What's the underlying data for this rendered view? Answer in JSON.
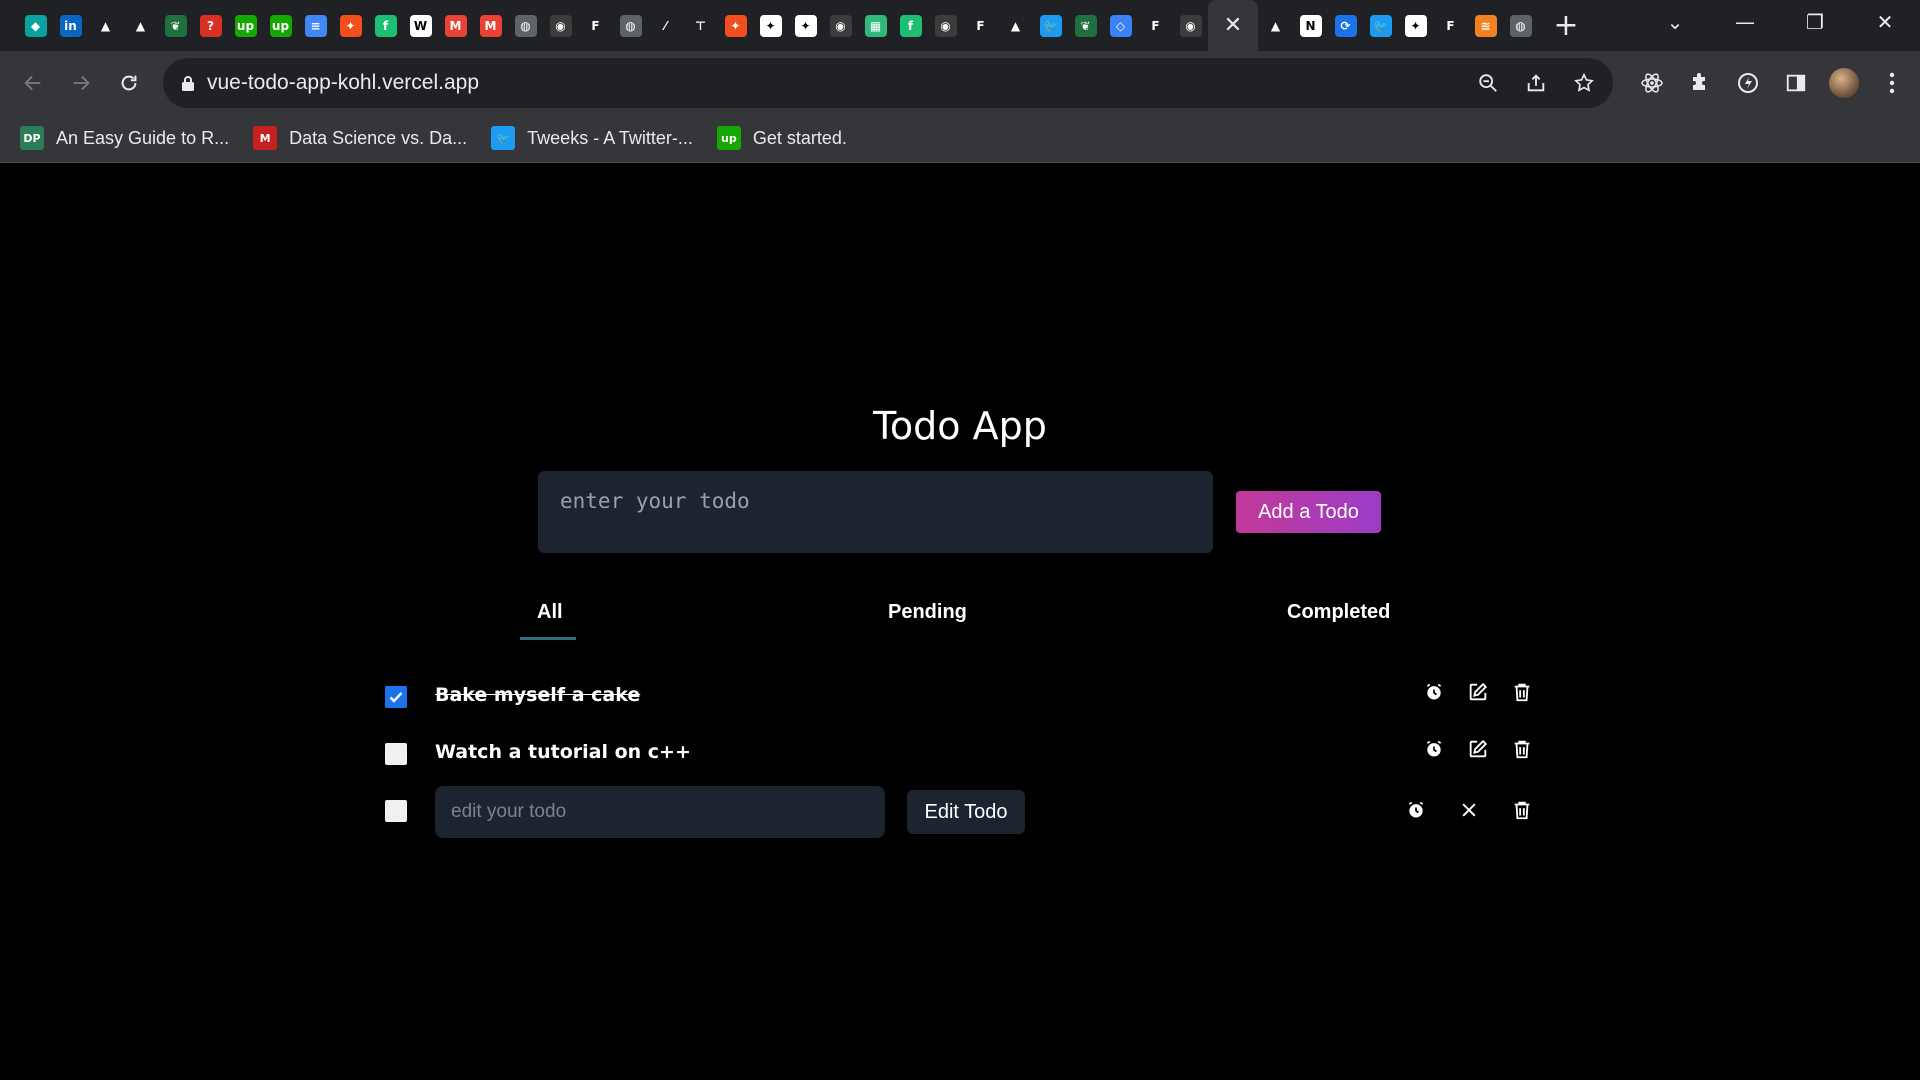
{
  "browser": {
    "tab_favicons": [
      {
        "name": "sourcegraph-icon",
        "glyph": "◆",
        "color": "#0aa2a0"
      },
      {
        "name": "linkedin-icon",
        "glyph": "in",
        "color": "#0a66c2"
      },
      {
        "name": "triangle-icon",
        "glyph": "▲",
        "color": "#202124"
      },
      {
        "name": "triangle-icon",
        "glyph": "▲",
        "color": "#202124"
      },
      {
        "name": "mongodb-leaf-icon",
        "glyph": "❦",
        "color": "#1f6f3f"
      },
      {
        "name": "question-icon",
        "glyph": "?",
        "color": "#d93025"
      },
      {
        "name": "upwork-icon",
        "glyph": "up",
        "color": "#14a800"
      },
      {
        "name": "upwork-icon",
        "glyph": "up",
        "color": "#14a800"
      },
      {
        "name": "google-docs-icon",
        "glyph": "≡",
        "color": "#4285f4"
      },
      {
        "name": "figma-icon",
        "glyph": "✦",
        "color": "#f24e1e"
      },
      {
        "name": "fiverr-icon",
        "glyph": "f",
        "color": "#1dbf73"
      },
      {
        "name": "wikipedia-icon",
        "glyph": "W",
        "color": "#ffffff"
      },
      {
        "name": "gmail-icon",
        "glyph": "M",
        "color": "#ea4335"
      },
      {
        "name": "gmail-icon",
        "glyph": "M",
        "color": "#ea4335"
      },
      {
        "name": "globe-icon",
        "glyph": "◍",
        "color": "#5f6368"
      },
      {
        "name": "github-icon",
        "glyph": "◉",
        "color": "#3c3c3c"
      },
      {
        "name": "f-letter-icon",
        "glyph": "F",
        "color": "#202124"
      },
      {
        "name": "globe-icon",
        "glyph": "◍",
        "color": "#5f6368"
      },
      {
        "name": "slash-icon",
        "glyph": "⁄",
        "color": "#202124"
      },
      {
        "name": "tool-icon",
        "glyph": "⊤",
        "color": "#202124"
      },
      {
        "name": "figma-icon",
        "glyph": "✦",
        "color": "#f24e1e"
      },
      {
        "name": "sparkle-icon",
        "glyph": "✦",
        "color": "#ffffff"
      },
      {
        "name": "sparkle-icon",
        "glyph": "✦",
        "color": "#ffffff"
      },
      {
        "name": "github-icon",
        "glyph": "◉",
        "color": "#3c3c3c"
      },
      {
        "name": "sheet-icon",
        "glyph": "▦",
        "color": "#2fb97a"
      },
      {
        "name": "fiverr-icon",
        "glyph": "f",
        "color": "#1dbf73"
      },
      {
        "name": "github-icon",
        "glyph": "◉",
        "color": "#3c3c3c"
      },
      {
        "name": "f-letter-icon",
        "glyph": "F",
        "color": "#202124"
      },
      {
        "name": "triangle-icon",
        "glyph": "▲",
        "color": "#202124"
      },
      {
        "name": "twitter-icon",
        "glyph": "🐦",
        "color": "#1d9bf0"
      },
      {
        "name": "mongodb-leaf-icon",
        "glyph": "❦",
        "color": "#1f6f3f"
      },
      {
        "name": "diamond-icon",
        "glyph": "◇",
        "color": "#3b82f6"
      },
      {
        "name": "f-letter-icon",
        "glyph": "F",
        "color": "#202124"
      },
      {
        "name": "github-icon",
        "glyph": "◉",
        "color": "#3c3c3c"
      }
    ],
    "tab_favicons_after": [
      {
        "name": "triangle-icon",
        "glyph": "▲",
        "color": "#202124"
      },
      {
        "name": "notion-icon",
        "glyph": "N",
        "color": "#ffffff"
      },
      {
        "name": "refresh-blue-icon",
        "glyph": "⟳",
        "color": "#1a73e8"
      },
      {
        "name": "twitter-icon",
        "glyph": "🐦",
        "color": "#1d9bf0"
      },
      {
        "name": "sparkle-icon",
        "glyph": "✦",
        "color": "#ffffff"
      },
      {
        "name": "f-letter-icon",
        "glyph": "F",
        "color": "#202124"
      },
      {
        "name": "stackoverflow-icon",
        "glyph": "≋",
        "color": "#f48024"
      },
      {
        "name": "globe-icon",
        "glyph": "◍",
        "color": "#5f6368"
      }
    ],
    "url": "vue-todo-app-kohl.vercel.app",
    "bookmarks": [
      {
        "icon": "DP",
        "color": "#2e7d57",
        "label": "An Easy Guide to R..."
      },
      {
        "icon": "M",
        "color": "#c5221f",
        "label": "Data Science vs. Da..."
      },
      {
        "icon": "🐦",
        "color": "#1d9bf0",
        "label": "Tweeks - A Twitter-..."
      },
      {
        "icon": "up",
        "color": "#14a800",
        "label": "Get started."
      }
    ]
  },
  "app": {
    "title": "Todo App",
    "input_placeholder": "enter your todo",
    "add_button": "Add a Todo",
    "accent_gradient": [
      "#c13a98",
      "#9b3cc7"
    ],
    "tabs": [
      {
        "label": "All",
        "active": true
      },
      {
        "label": "Pending",
        "active": false
      },
      {
        "label": "Completed",
        "active": false
      }
    ],
    "todos": [
      {
        "text": "Bake myself a cake",
        "completed": true
      },
      {
        "text": "Watch a tutorial on c++",
        "completed": false
      }
    ],
    "edit_row": {
      "placeholder": "edit your todo",
      "button": "Edit Todo"
    }
  }
}
